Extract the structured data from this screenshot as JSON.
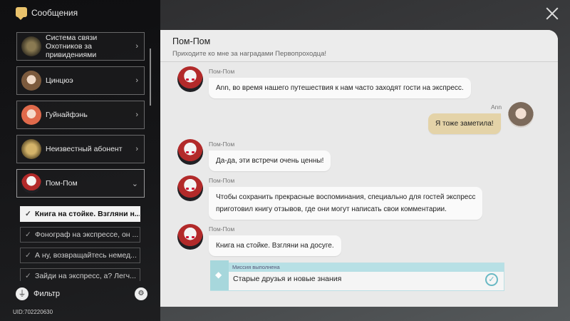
{
  "app": {
    "title": "Сообщения",
    "uid": "UID:702220630"
  },
  "contacts": [
    {
      "name": "Система связи Охотников за привидениями",
      "avatar": "ghost-hunters-avatar"
    },
    {
      "name": "Цинцюэ",
      "avatar": "qingque-avatar"
    },
    {
      "name": "Гуйнайфэнь",
      "avatar": "guinaifen-avatar"
    },
    {
      "name": "Неизвестный абонент",
      "avatar": "unknown-avatar"
    },
    {
      "name": "Пом-Пом",
      "avatar": "pom-pom-avatar"
    }
  ],
  "threads": [
    "Книга на стойке. Взгляни н...",
    "Фонограф на экспрессе, он ...",
    "А ну, возвращайтесь немед...",
    "Зайди на экспресс, а? Легч..."
  ],
  "filter": {
    "label": "Фильтр"
  },
  "chat": {
    "name": "Пом-Пом",
    "status": "Приходите ко мне за наградами Первопроходца!",
    "messages": [
      {
        "sender": "Пом-Пом",
        "text": "Ann, во время нашего путешествия к нам часто заходят гости на экспресс."
      },
      {
        "sender": "Ann",
        "text": "Я тоже заметила!"
      },
      {
        "sender": "Пом-Пом",
        "text": "Да-да, эти встречи очень ценны!"
      },
      {
        "sender": "Пом-Пом",
        "line1": "Чтобы сохранить прекрасные воспоминания, специально для гостей экспресс",
        "line2": "приготовил книгу отзывов, где они могут написать свои комментарии."
      },
      {
        "sender": "Пом-Пом",
        "text": "Книга на стойке. Взгляни на досуге."
      }
    ],
    "mission": {
      "header": "Миссия выполнена",
      "title": "Старые друзья и новые знания"
    }
  },
  "colors": {
    "accent": "#e4d3a8",
    "mission": "#a7d7dc"
  }
}
